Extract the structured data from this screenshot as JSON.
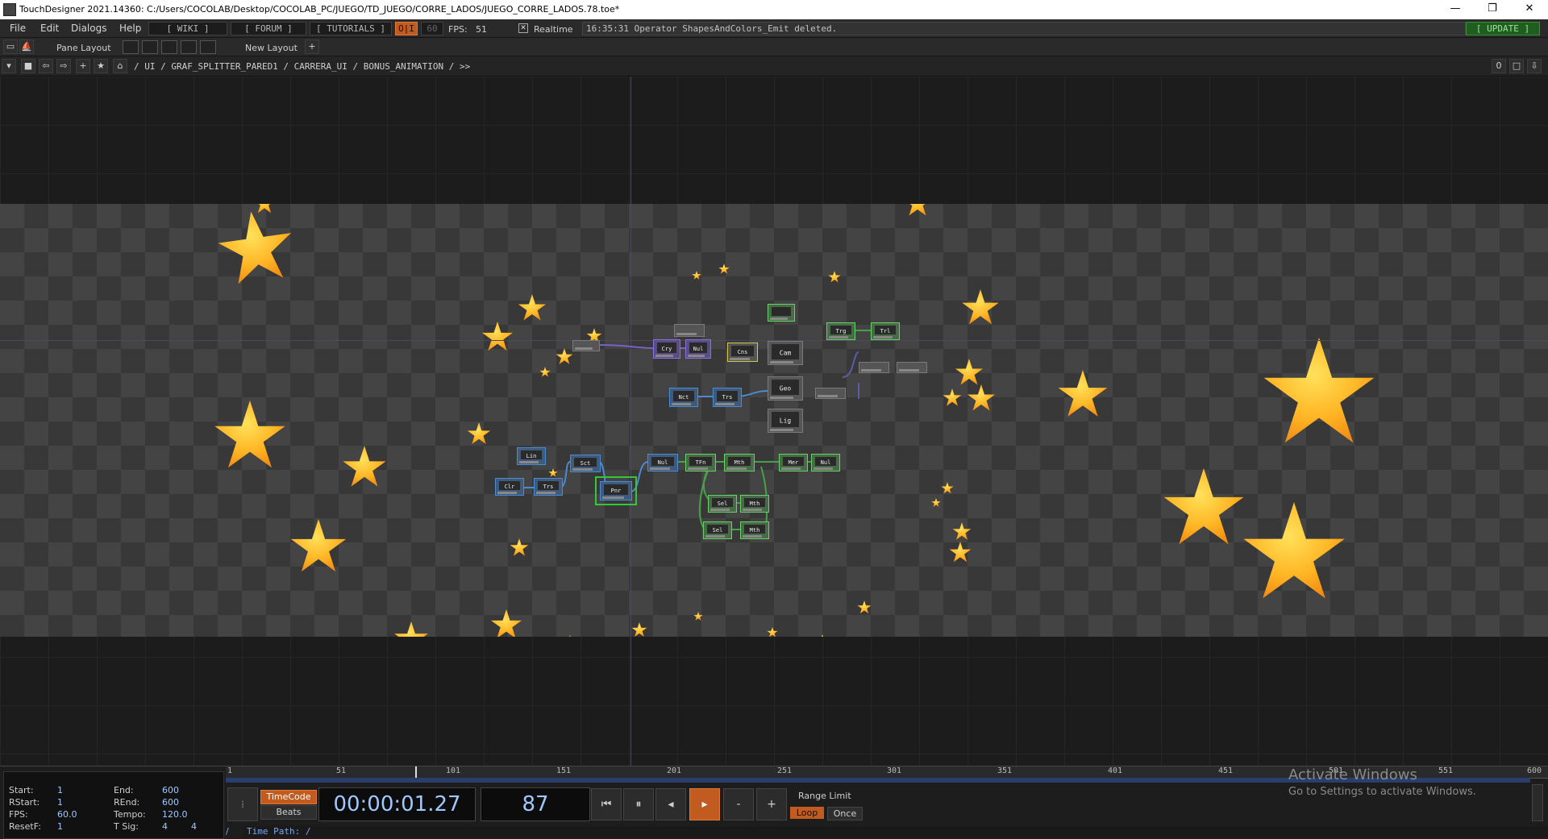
{
  "window": {
    "title": "TouchDesigner 2021.14360: C:/Users/COCOLAB/Desktop/COCOLAB_PC/JUEGO/TD_JUEGO/CORRE_LADOS/JUEGO_CORRE_LADOS.78.toe*",
    "minimize": "—",
    "restore": "❐",
    "close": "✕"
  },
  "menu": {
    "items": [
      "File",
      "Edit",
      "Dialogs",
      "Help"
    ],
    "wiki": "[ WIKI ]",
    "forum": "[ FORUM ]",
    "tutorials": "[ TUTORIALS ]",
    "oi": "O|I",
    "fps_box": "60",
    "fps_label": "FPS:",
    "fps_value": "51",
    "realtime_label": "Realtime",
    "status_message": "16:35:31 Operator ShapesAndColors_Emit deleted.",
    "update": "[ UPDATE ]"
  },
  "panebar": {
    "pane_layout": "Pane Layout",
    "new_layout": "New Layout",
    "add": "+"
  },
  "path": {
    "crumbs": "/ UI / GRAF_SPLITTER_PARED1 / CARRERA_UI / BONUS_ANIMATION / >>",
    "counter": "0"
  },
  "nodes": [
    "Cry",
    "Nul",
    "Cns",
    "Cam",
    "Trg",
    "Trl",
    "Nct",
    "Trs",
    "Geo",
    "Lig",
    "Lin",
    "Sct",
    "Nul",
    "TFn",
    "Mth",
    "Mer",
    "Nul",
    "Clr",
    "Trs",
    "Pnr",
    "Sel",
    "Mth",
    "Sel",
    "Mth"
  ],
  "timeline": {
    "ticks": [
      "1",
      "51",
      "101",
      "151",
      "201",
      "251",
      "301",
      "351",
      "401",
      "451",
      "501",
      "551",
      "600"
    ],
    "range": {
      "start_label": "Start:",
      "start": "1",
      "end_label": "End:",
      "end": "600",
      "rstart_label": "RStart:",
      "rstart": "1",
      "rend_label": "REnd:",
      "rend": "600",
      "fps_label": "FPS:",
      "fps": "60.0",
      "tempo_label": "Tempo:",
      "tempo": "120.0",
      "resetf_label": "ResetF:",
      "resetf": "1",
      "tsig_label": "T Sig:",
      "tsig_a": "4",
      "tsig_b": "4"
    },
    "timecode_label": "TimeCode",
    "beats_label": "Beats",
    "timecode": "00:00:01.27",
    "frame": "87",
    "range_limit": "Range Limit",
    "loop": "Loop",
    "once": "Once",
    "time_path": "Time Path: /",
    "watermark_title": "Activate Windows",
    "watermark_sub": "Go to Settings to activate Windows."
  }
}
